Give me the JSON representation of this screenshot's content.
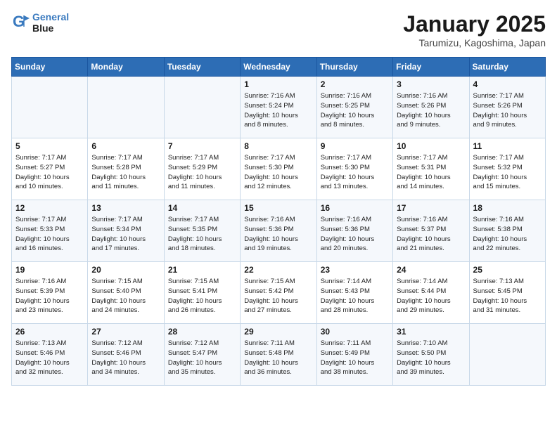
{
  "header": {
    "logo_line1": "General",
    "logo_line2": "Blue",
    "month": "January 2025",
    "location": "Tarumizu, Kagoshima, Japan"
  },
  "days_of_week": [
    "Sunday",
    "Monday",
    "Tuesday",
    "Wednesday",
    "Thursday",
    "Friday",
    "Saturday"
  ],
  "weeks": [
    [
      {
        "day": "",
        "info": ""
      },
      {
        "day": "",
        "info": ""
      },
      {
        "day": "",
        "info": ""
      },
      {
        "day": "1",
        "info": "Sunrise: 7:16 AM\nSunset: 5:24 PM\nDaylight: 10 hours\nand 8 minutes."
      },
      {
        "day": "2",
        "info": "Sunrise: 7:16 AM\nSunset: 5:25 PM\nDaylight: 10 hours\nand 8 minutes."
      },
      {
        "day": "3",
        "info": "Sunrise: 7:16 AM\nSunset: 5:26 PM\nDaylight: 10 hours\nand 9 minutes."
      },
      {
        "day": "4",
        "info": "Sunrise: 7:17 AM\nSunset: 5:26 PM\nDaylight: 10 hours\nand 9 minutes."
      }
    ],
    [
      {
        "day": "5",
        "info": "Sunrise: 7:17 AM\nSunset: 5:27 PM\nDaylight: 10 hours\nand 10 minutes."
      },
      {
        "day": "6",
        "info": "Sunrise: 7:17 AM\nSunset: 5:28 PM\nDaylight: 10 hours\nand 11 minutes."
      },
      {
        "day": "7",
        "info": "Sunrise: 7:17 AM\nSunset: 5:29 PM\nDaylight: 10 hours\nand 11 minutes."
      },
      {
        "day": "8",
        "info": "Sunrise: 7:17 AM\nSunset: 5:30 PM\nDaylight: 10 hours\nand 12 minutes."
      },
      {
        "day": "9",
        "info": "Sunrise: 7:17 AM\nSunset: 5:30 PM\nDaylight: 10 hours\nand 13 minutes."
      },
      {
        "day": "10",
        "info": "Sunrise: 7:17 AM\nSunset: 5:31 PM\nDaylight: 10 hours\nand 14 minutes."
      },
      {
        "day": "11",
        "info": "Sunrise: 7:17 AM\nSunset: 5:32 PM\nDaylight: 10 hours\nand 15 minutes."
      }
    ],
    [
      {
        "day": "12",
        "info": "Sunrise: 7:17 AM\nSunset: 5:33 PM\nDaylight: 10 hours\nand 16 minutes."
      },
      {
        "day": "13",
        "info": "Sunrise: 7:17 AM\nSunset: 5:34 PM\nDaylight: 10 hours\nand 17 minutes."
      },
      {
        "day": "14",
        "info": "Sunrise: 7:17 AM\nSunset: 5:35 PM\nDaylight: 10 hours\nand 18 minutes."
      },
      {
        "day": "15",
        "info": "Sunrise: 7:16 AM\nSunset: 5:36 PM\nDaylight: 10 hours\nand 19 minutes."
      },
      {
        "day": "16",
        "info": "Sunrise: 7:16 AM\nSunset: 5:36 PM\nDaylight: 10 hours\nand 20 minutes."
      },
      {
        "day": "17",
        "info": "Sunrise: 7:16 AM\nSunset: 5:37 PM\nDaylight: 10 hours\nand 21 minutes."
      },
      {
        "day": "18",
        "info": "Sunrise: 7:16 AM\nSunset: 5:38 PM\nDaylight: 10 hours\nand 22 minutes."
      }
    ],
    [
      {
        "day": "19",
        "info": "Sunrise: 7:16 AM\nSunset: 5:39 PM\nDaylight: 10 hours\nand 23 minutes."
      },
      {
        "day": "20",
        "info": "Sunrise: 7:15 AM\nSunset: 5:40 PM\nDaylight: 10 hours\nand 24 minutes."
      },
      {
        "day": "21",
        "info": "Sunrise: 7:15 AM\nSunset: 5:41 PM\nDaylight: 10 hours\nand 26 minutes."
      },
      {
        "day": "22",
        "info": "Sunrise: 7:15 AM\nSunset: 5:42 PM\nDaylight: 10 hours\nand 27 minutes."
      },
      {
        "day": "23",
        "info": "Sunrise: 7:14 AM\nSunset: 5:43 PM\nDaylight: 10 hours\nand 28 minutes."
      },
      {
        "day": "24",
        "info": "Sunrise: 7:14 AM\nSunset: 5:44 PM\nDaylight: 10 hours\nand 29 minutes."
      },
      {
        "day": "25",
        "info": "Sunrise: 7:13 AM\nSunset: 5:45 PM\nDaylight: 10 hours\nand 31 minutes."
      }
    ],
    [
      {
        "day": "26",
        "info": "Sunrise: 7:13 AM\nSunset: 5:46 PM\nDaylight: 10 hours\nand 32 minutes."
      },
      {
        "day": "27",
        "info": "Sunrise: 7:12 AM\nSunset: 5:46 PM\nDaylight: 10 hours\nand 34 minutes."
      },
      {
        "day": "28",
        "info": "Sunrise: 7:12 AM\nSunset: 5:47 PM\nDaylight: 10 hours\nand 35 minutes."
      },
      {
        "day": "29",
        "info": "Sunrise: 7:11 AM\nSunset: 5:48 PM\nDaylight: 10 hours\nand 36 minutes."
      },
      {
        "day": "30",
        "info": "Sunrise: 7:11 AM\nSunset: 5:49 PM\nDaylight: 10 hours\nand 38 minutes."
      },
      {
        "day": "31",
        "info": "Sunrise: 7:10 AM\nSunset: 5:50 PM\nDaylight: 10 hours\nand 39 minutes."
      },
      {
        "day": "",
        "info": ""
      }
    ]
  ]
}
